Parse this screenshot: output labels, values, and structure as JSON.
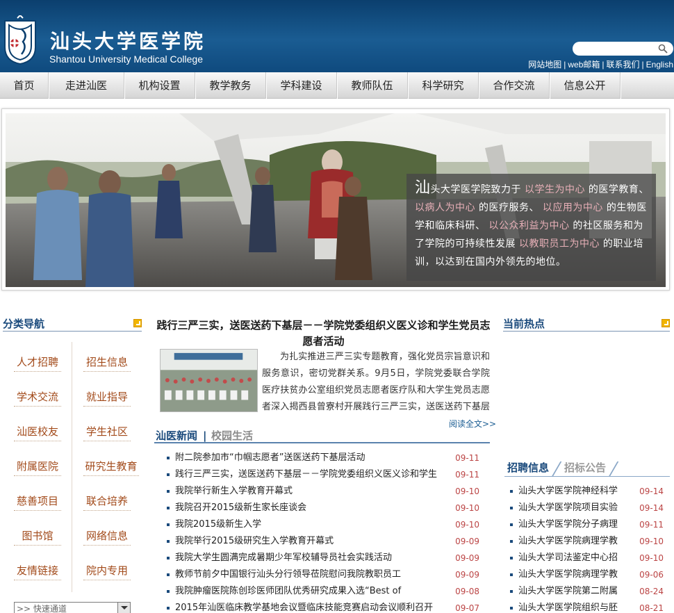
{
  "header": {
    "title_cn": "汕头大学医学院",
    "title_en": "Shantou University Medical College",
    "links": [
      "网站地图",
      "web邮箱",
      "联系我们",
      "English"
    ],
    "separator": "|"
  },
  "nav": {
    "items": [
      "首页",
      "走进汕医",
      "机构设置",
      "教学教务",
      "学科建设",
      "教师队伍",
      "科学研究",
      "合作交流",
      "信息公开"
    ]
  },
  "banner": {
    "quote_first": "汕",
    "quote_parts": [
      {
        "text": "头大学医学院致力于 ",
        "hl": false
      },
      {
        "text": "以学生为中心",
        "hl": true
      },
      {
        "text": " 的医学教育、 ",
        "hl": false
      },
      {
        "text": "以病人为中心",
        "hl": true
      },
      {
        "text": " 的医疗服务、 ",
        "hl": false
      },
      {
        "text": "以应用为中心",
        "hl": true
      },
      {
        "text": " 的生物医学和临床科研、 ",
        "hl": false
      },
      {
        "text": "以公众利益为中心",
        "hl": true
      },
      {
        "text": " 的社区服务和为了学院的可持续性发展 ",
        "hl": false
      },
      {
        "text": "以教职员工为中心",
        "hl": true
      },
      {
        "text": " 的职业培训，以达到在国内外领先的地位。",
        "hl": false
      }
    ],
    "colors": {
      "highlight": "#e8b0b8"
    }
  },
  "left": {
    "title": "分类导航",
    "col1": [
      "人才招聘",
      "学术交流",
      "汕医校友",
      "附属医院",
      "慈善项目",
      "图书馆",
      "友情链接"
    ],
    "col2": [
      "招生信息",
      "就业指导",
      "学生社区",
      "研究生教育",
      "联合培养",
      "网络信息",
      "院内专用"
    ],
    "quick_select": ">> 快速通道"
  },
  "middle": {
    "headline": "践行三严三实，送医送药下基层－－学院党委组织义医义诊和学生党员志愿者活动",
    "summary": "为扎实推进三严三实专题教育，强化党员宗旨意识和服务意识，密切党群关系。9月5日，学院党委联合学院医疗扶贫办公室组织党员志愿者医疗队和大学生党员志愿者深入揭西县曾寮村开展践行三严三实，送医送药下基层活",
    "read_more": "阅读全文>>",
    "tab_active": "汕医新闻",
    "tab_sep": "|",
    "tab_inactive": "校园生活",
    "news": [
      {
        "title": "附二院参加市“巾帼志愿者”送医送药下基层活动",
        "date": "09-11"
      },
      {
        "title": "践行三严三实，送医送药下基层－－学院党委组织义医义诊和学生",
        "date": "09-11"
      },
      {
        "title": "我院举行新生入学教育开幕式",
        "date": "09-10"
      },
      {
        "title": "我院召开2015级新生家长座谈会",
        "date": "09-10"
      },
      {
        "title": "我院2015级新生入学",
        "date": "09-10"
      },
      {
        "title": "我院举行2015级研究生入学教育开幕式",
        "date": "09-09"
      },
      {
        "title": "我院大学生圆满完成暑期少年军校辅导员社会实践活动",
        "date": "09-09"
      },
      {
        "title": "教师节前夕中国银行汕头分行领导莅院慰问我院教职员工",
        "date": "09-09"
      },
      {
        "title": "我院肿瘤医院陈创珍医师团队优秀研究成果入选“Best of",
        "date": "09-08"
      },
      {
        "title": "2015年汕医临床教学基地会议暨临床技能竞赛启动会议顺利召开",
        "date": "09-07"
      }
    ]
  },
  "right": {
    "title": "当前热点",
    "tab_active": "招聘信息",
    "tab_inactive": "招标公告",
    "items": [
      {
        "title": "汕头大学医学院神经科学",
        "date": "09-14"
      },
      {
        "title": "汕头大学医学院项目实验",
        "date": "09-14"
      },
      {
        "title": "汕头大学医学院分子病理",
        "date": "09-11"
      },
      {
        "title": "汕头大学医学院病理学教",
        "date": "09-10"
      },
      {
        "title": "汕头大学司法鉴定中心招",
        "date": "09-10"
      },
      {
        "title": "汕头大学医学院病理学教",
        "date": "09-06"
      },
      {
        "title": "汕头大学医学院第二附属",
        "date": "08-24"
      },
      {
        "title": "汕头大学医学院组织与胚",
        "date": "08-21"
      }
    ]
  },
  "colors": {
    "header_blue": "#1a5c92",
    "title_blue": "#1a4a7c",
    "category_text": "#a24a1a",
    "date_red": "#b44444",
    "tab_inactive": "#8a8a8a"
  }
}
